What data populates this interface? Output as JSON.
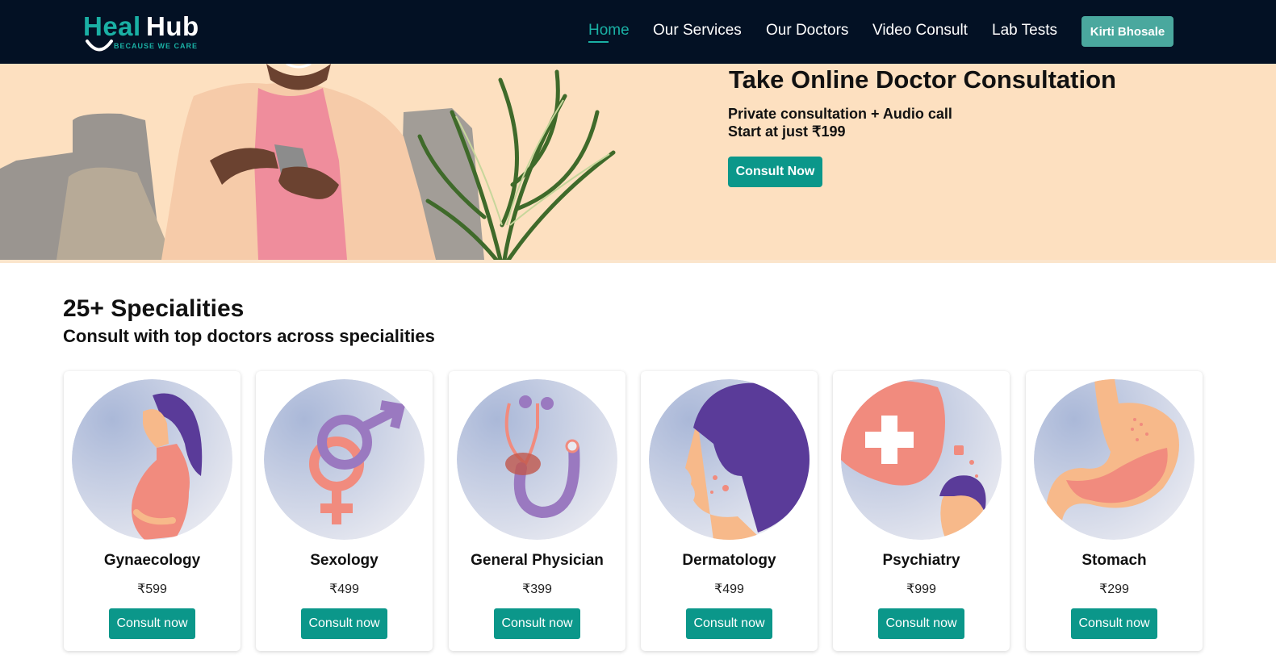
{
  "brand": {
    "name_part1": "Heal",
    "name_part2": "Hub",
    "tagline": "BECAUSE WE CARE",
    "teal": "#1ab0a4"
  },
  "nav": {
    "links": [
      {
        "label": "Home",
        "active": true
      },
      {
        "label": "Our Services",
        "active": false
      },
      {
        "label": "Our Doctors",
        "active": false
      },
      {
        "label": "Video Consult",
        "active": false
      },
      {
        "label": "Lab Tests",
        "active": false
      }
    ],
    "user_label": "Kirti Bhosale"
  },
  "hero": {
    "title": "Take Online Doctor Consultation",
    "line1": "Private consultation + Audio call",
    "line2": "Start at just ₹199",
    "button_label": "Consult Now",
    "background_color": "#fde0c0"
  },
  "specialities": {
    "title": "25+ Specialities",
    "subtitle": "Consult with top doctors across specialities",
    "items": [
      {
        "name": "Gynaecology",
        "price": "₹599",
        "button_label": "Consult now",
        "illustration": "pregnant-woman-icon"
      },
      {
        "name": "Sexology",
        "price": "₹499",
        "button_label": "Consult now",
        "illustration": "gender-symbols-icon"
      },
      {
        "name": "General Physician",
        "price": "₹399",
        "button_label": "Consult now",
        "illustration": "stethoscope-icon"
      },
      {
        "name": "Dermatology",
        "price": "₹499",
        "button_label": "Consult now",
        "illustration": "skin-face-icon"
      },
      {
        "name": "Psychiatry",
        "price": "₹999",
        "button_label": "Consult now",
        "illustration": "mind-health-icon"
      },
      {
        "name": "Stomach",
        "price": "₹299",
        "button_label": "Consult now",
        "illustration": "stomach-icon"
      }
    ]
  },
  "colors": {
    "nav_bg": "#031124",
    "button_teal": "#0b978a",
    "user_button": "#4aa89e"
  }
}
